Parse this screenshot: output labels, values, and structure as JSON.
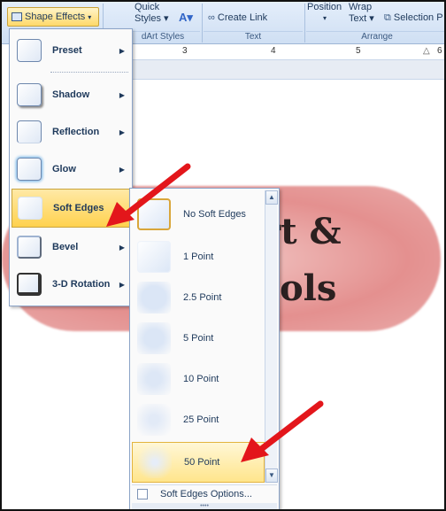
{
  "ribbon": {
    "shape_effects_label": "Shape Effects",
    "quick_styles_label": "Quick Styles",
    "quick_styles_top": "Quick",
    "styles_row": "Styles ▾",
    "create_link_label": "Create Link",
    "position_label": "Position",
    "wrap_label": "Wrap",
    "wrap_text_label": "Text ▾",
    "selection_label": "Selection P",
    "group_wordart": "dArt Styles",
    "group_text": "Text",
    "group_arrange": "Arrange"
  },
  "ruler": {
    "numbers": [
      "3",
      "4",
      "5",
      "6"
    ]
  },
  "document": {
    "line1": "rt &",
    "line2": "ols"
  },
  "effects_menu": {
    "items": [
      {
        "label": "Preset",
        "accel": "P"
      },
      {
        "label": "Shadow",
        "accel": "S"
      },
      {
        "label": "Reflection",
        "accel": "R"
      },
      {
        "label": "Glow",
        "accel": "G"
      },
      {
        "label": "Soft Edges",
        "accel": "E"
      },
      {
        "label": "Bevel",
        "accel": "B"
      },
      {
        "label": "3-D Rotation",
        "accel": "D"
      }
    ]
  },
  "soft_edges_menu": {
    "items": [
      {
        "label": "No Soft Edges",
        "blur": 0
      },
      {
        "label": "1 Point",
        "blur": 1
      },
      {
        "label": "2.5 Point",
        "blur": 2.5
      },
      {
        "label": "5 Point",
        "blur": 5
      },
      {
        "label": "10 Point",
        "blur": 10
      },
      {
        "label": "25 Point",
        "blur": 25
      },
      {
        "label": "50 Point",
        "blur": 50
      }
    ],
    "options_label": "Soft Edges Options..."
  },
  "colors": {
    "accent": "#ffd24f",
    "arrow": "#e3161b",
    "menu_border": "#8ba3c7"
  }
}
